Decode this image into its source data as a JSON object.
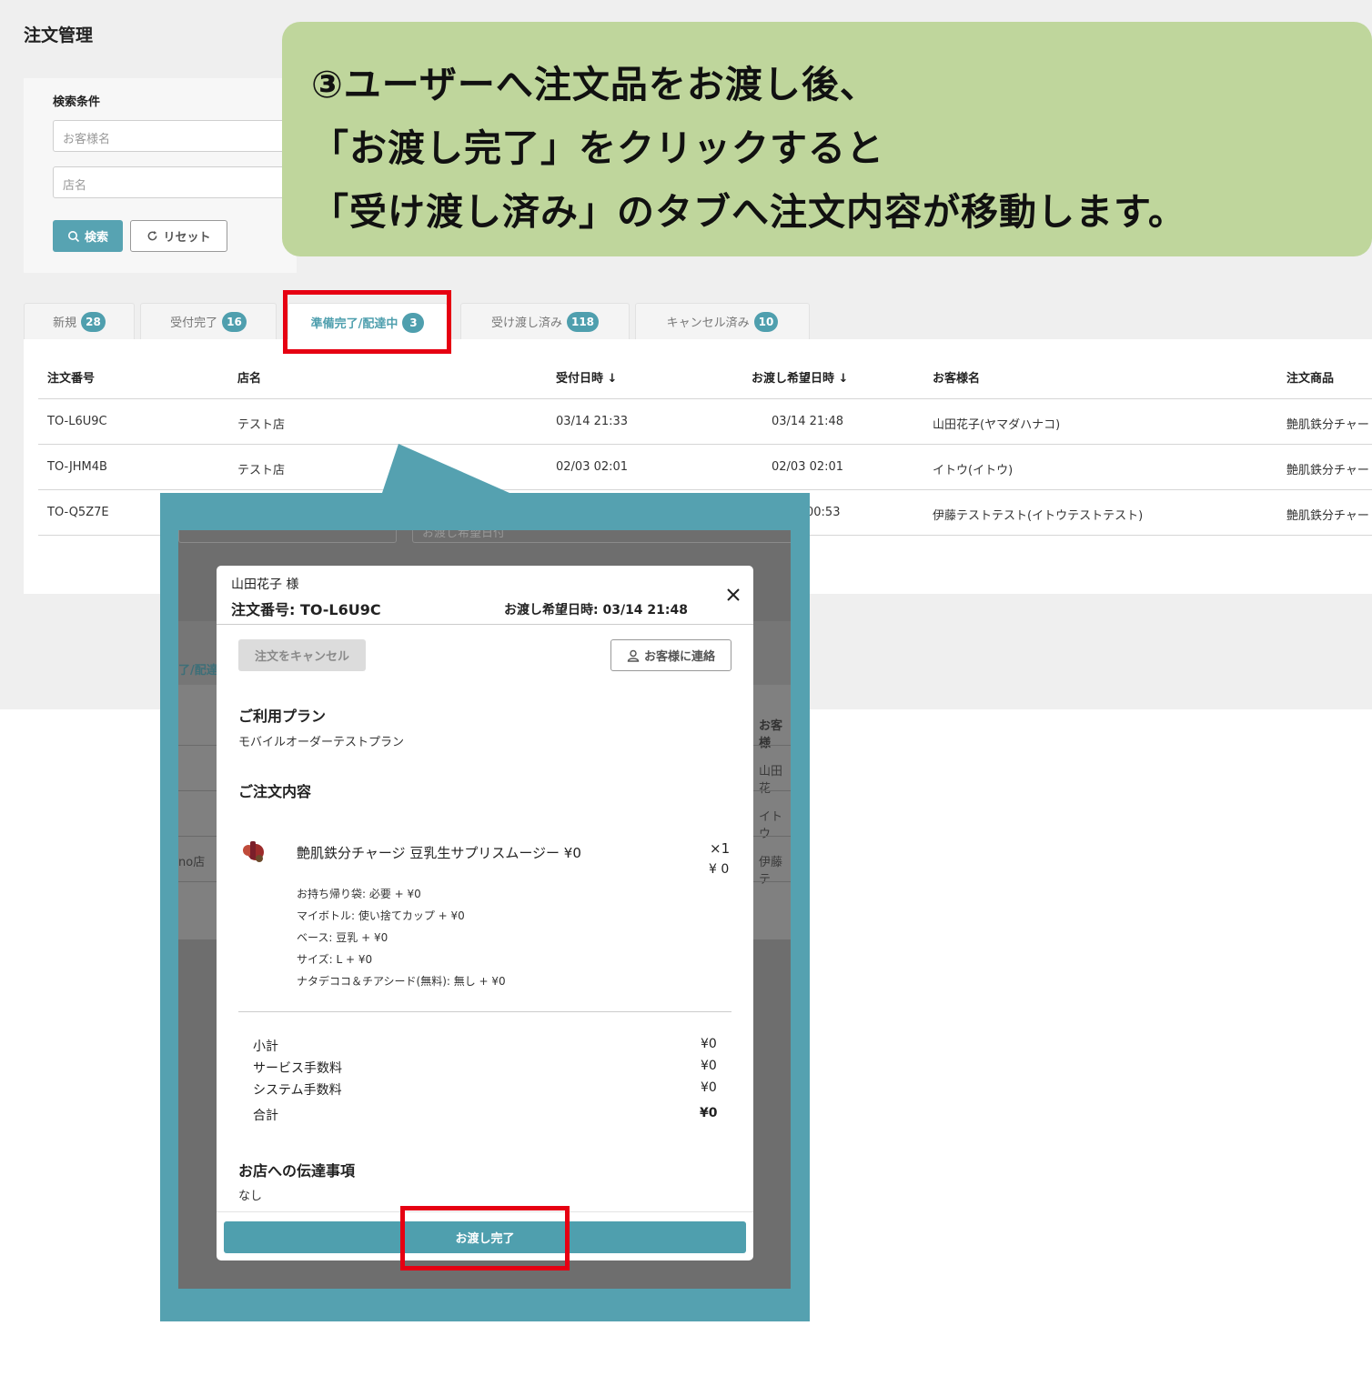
{
  "page": {
    "title": "注文管理"
  },
  "search": {
    "heading": "検索条件",
    "customer_placeholder": "お客様名",
    "shop_placeholder": "店名",
    "search_label": "検索",
    "reset_label": "リセット"
  },
  "tabs": [
    {
      "label": "新規",
      "count": "28"
    },
    {
      "label": "受付完了",
      "count": "16"
    },
    {
      "label": "準備完了/配達中",
      "count": "3"
    },
    {
      "label": "受け渡し済み",
      "count": "118"
    },
    {
      "label": "キャンセル済み",
      "count": "10"
    }
  ],
  "table": {
    "headers": [
      "注文番号",
      "店名",
      "受付日時 ↓",
      "お渡し希望日時 ↓",
      "お客様名",
      "注文商品"
    ],
    "rows": [
      {
        "order_no": "TO-L6U9C",
        "shop": "テスト店",
        "received": "03/14 21:33",
        "desired": "03/14 21:48",
        "customer": "山田花子(ヤマダハナコ)",
        "item": "艶肌鉄分チャー"
      },
      {
        "order_no": "TO-JHM4B",
        "shop": "テスト店",
        "received": "02/03 02:01",
        "desired": "02/03 02:01",
        "customer": "イトウ(イトウ)",
        "item": "艶肌鉄分チャー"
      },
      {
        "order_no": "TO-Q5Z7E",
        "shop": "",
        "received": "",
        "desired": "00:53",
        "customer": "伊藤テストテスト(イトウテストテスト)",
        "item": "艶肌鉄分チャー"
      }
    ]
  },
  "callout": {
    "lines": [
      "③ユーザーへ注文品をお渡し後、",
      "「お渡し完了」をクリックすると",
      "「受け渡し済み」のタブへ注文内容が移動します。"
    ]
  },
  "zoom_background": {
    "tab_fragment": "了/配達",
    "header_fragment": "お客様",
    "cells": [
      "山田花",
      "イトウ",
      "伊藤テ"
    ],
    "shop_fragment": "no店",
    "field_fragment": "お渡し希望日付"
  },
  "modal": {
    "customer": "山田花子 様",
    "order_no": "注文番号: TO-L6U9C",
    "desired_time": "お渡し希望日時: 03/14 21:48",
    "close_icon": "×",
    "cancel_label": "注文をキャンセル",
    "contact_label": "お客様に連絡",
    "plan_heading": "ご利用プラン",
    "plan_name": "モバイルオーダーテストプラン",
    "order_heading": "ご注文内容",
    "item_name": "艶肌鉄分チャージ 豆乳生サプリスムージー ¥0",
    "item_qty": "×1",
    "item_price": "¥ 0",
    "options": [
      "お持ち帰り袋: 必要 + ¥0",
      "マイボトル: 使い捨てカップ + ¥0",
      "ベース: 豆乳 + ¥0",
      "サイズ: L + ¥0",
      "ナタデココ＆チアシード(無料): 無し + ¥0"
    ],
    "totals": [
      {
        "label": "小計",
        "value": "¥0"
      },
      {
        "label": "サービス手数料",
        "value": "¥0"
      },
      {
        "label": "システム手数料",
        "value": "¥0"
      },
      {
        "label": "合計",
        "value": "¥0"
      }
    ],
    "notes_heading": "お店への伝達事項",
    "notes_value": "なし",
    "complete_label": "お渡し完了"
  },
  "colors": {
    "accent": "#4f9fae",
    "callout": "#bfd69c",
    "highlight": "#e60012",
    "zoom_frame": "#55a1b0"
  }
}
